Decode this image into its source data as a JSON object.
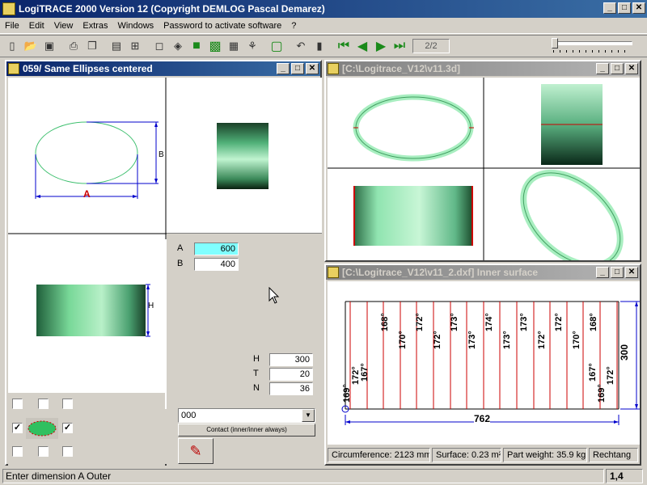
{
  "app": {
    "title": "LogiTRACE 2000  Version 12  (Copyright DEMLOG Pascal Demarez)"
  },
  "menu": [
    "File",
    "Edit",
    "View",
    "Extras",
    "Windows",
    "Password to activate software",
    "?"
  ],
  "toolbar": {
    "page_indicator": "2/2"
  },
  "zoom": {
    "level": 0
  },
  "window_main": {
    "title": "059/ Same Ellipses centered",
    "dim_label_a": "A",
    "dim_label_b": "B",
    "dim_label_h": "H",
    "fields": {
      "a_label": "A",
      "a_value": "600",
      "b_label": "B",
      "b_value": "400",
      "h_label": "H",
      "h_value": "300",
      "t_label": "T",
      "t_value": "20",
      "n_label": "N",
      "n_value": "36"
    },
    "combo_value": "000",
    "contact_button": "Contact (inner/inner always)"
  },
  "window_3d": {
    "title": "[C:\\Logitrace_V12\\v11.3d]"
  },
  "window_dxf": {
    "title": "[C:\\Logitrace_V12\\v11_2.dxf]  Inner surface",
    "angles_top": [
      "168°",
      "170°",
      "172°",
      "172°",
      "173°",
      "173°",
      "174°",
      "173°",
      "173°",
      "172°",
      "172°",
      "170°",
      "168°"
    ],
    "angles_bottom_left": [
      "169°",
      "172°",
      "167°"
    ],
    "angles_bottom_right": [
      "167°",
      "169°",
      "172°"
    ],
    "width_dim": "762",
    "height_dim": "300",
    "info": [
      "Circumference: 2123 mm",
      "Surface: 0.23 m²",
      "Part weight: 35.9 kg",
      "Rechtang"
    ]
  },
  "status": {
    "message": "Enter dimension A Outer",
    "coords": "1,4"
  },
  "colors": {
    "title_active": "#0a246a",
    "shape_green": "#90e0b0",
    "dim_blue": "#0000cc",
    "dim_red": "#cc0000"
  }
}
